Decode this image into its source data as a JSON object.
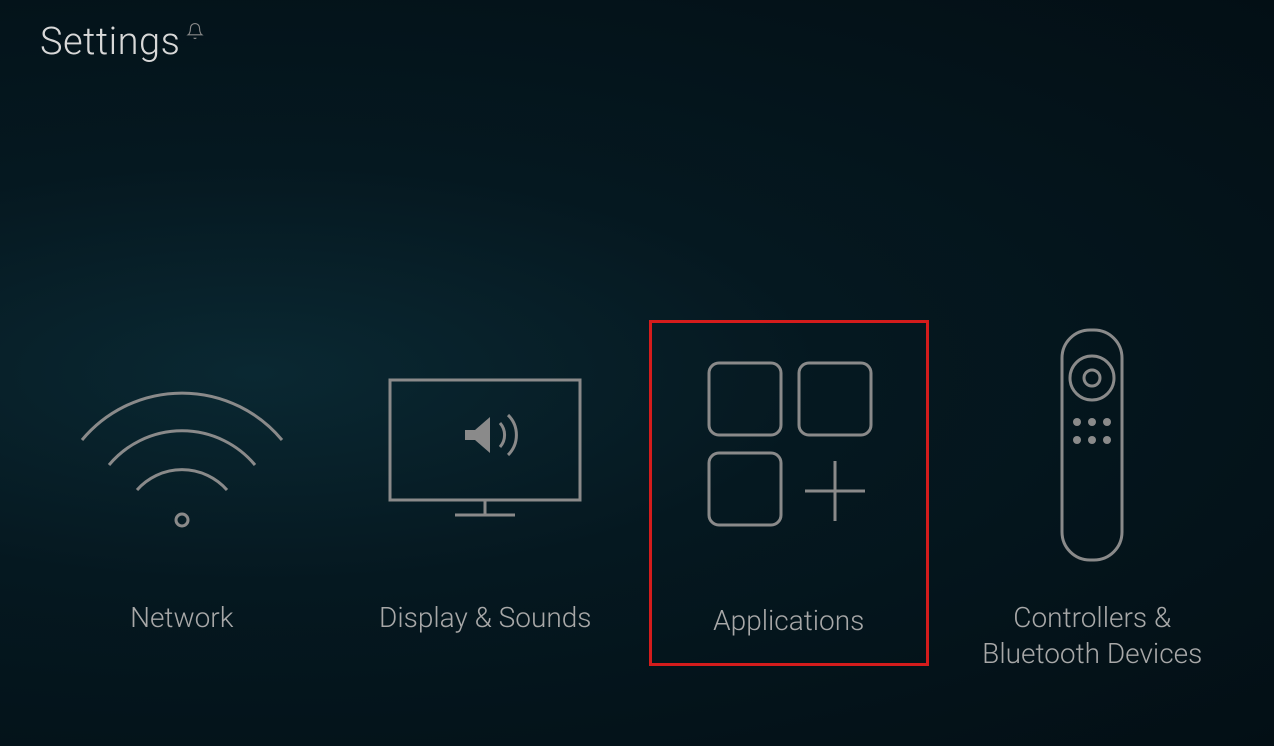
{
  "header": {
    "title": "Settings"
  },
  "tiles": {
    "network": {
      "label": "Network"
    },
    "display_sounds": {
      "label": "Display & Sounds"
    },
    "applications": {
      "label": "Applications",
      "highlighted": true
    },
    "controllers": {
      "label": "Controllers & Bluetooth Devices"
    }
  }
}
